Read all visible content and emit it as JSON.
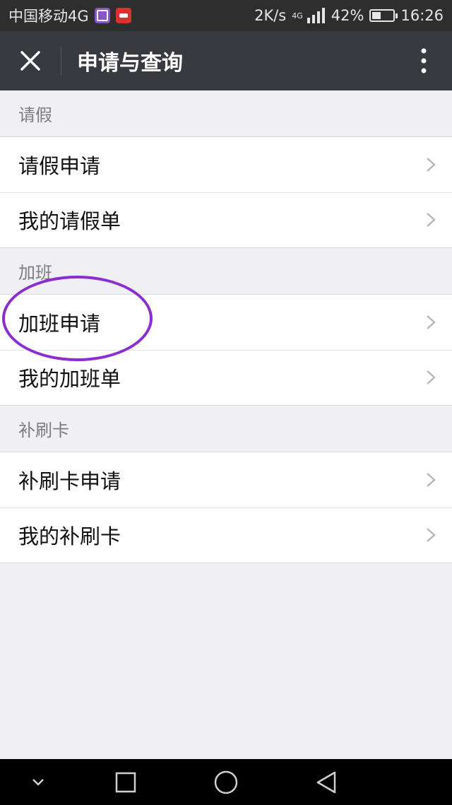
{
  "status_bar": {
    "carrier": "中国移动4G",
    "speed": "2K/s",
    "network": "4G",
    "battery": "42%",
    "battery_level": 0.42,
    "time": "16:26"
  },
  "header": {
    "title": "申请与查询",
    "close_icon": "close-icon",
    "more_icon": "more-vertical-icon"
  },
  "sections": [
    {
      "title": "请假",
      "items": [
        "请假申请",
        "我的请假单"
      ]
    },
    {
      "title": "加班",
      "items": [
        "加班申请",
        "我的加班单"
      ]
    },
    {
      "title": "补刷卡",
      "items": [
        "补刷卡申请",
        "我的补刷卡"
      ]
    }
  ],
  "colors": {
    "header_bg": "#393a3f",
    "status_bg": "#2e2e2e",
    "page_bg": "#efeff4",
    "highlight": "#8b2ed0"
  },
  "nav_bar": {
    "icons": [
      "chevron-down-icon",
      "recent-apps-icon",
      "home-icon",
      "back-icon"
    ]
  }
}
